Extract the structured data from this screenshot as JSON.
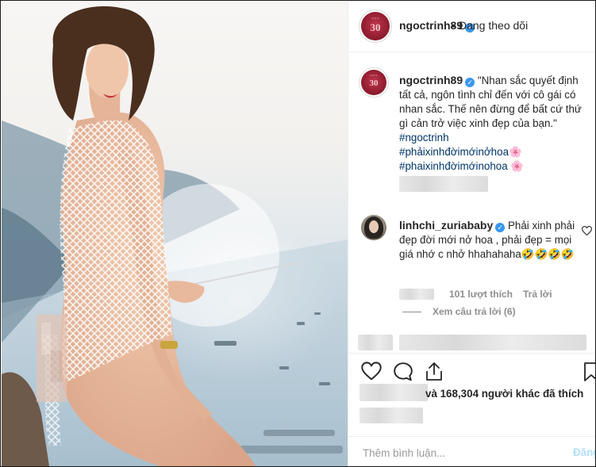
{
  "post": {
    "username": "ngoctrinh89",
    "follow_status": "Đang theo dõi",
    "avatar_badge": "30",
    "caption": "\"Nhan sắc quyết định tất cả, ngôn tình chỉ đến với cô gái có nhan sắc. Thế nên đừng để bất cứ thứ gì cản trở việc xinh đẹp của bạn.\"",
    "hashtags": [
      "#ngoctrinh",
      "#phảixinhđờimớinởhoa🌸",
      "#phaixinhđờimớinohoa 🌸"
    ]
  },
  "comment": {
    "username": "linhchi_zuriababy",
    "text": "Phải xinh phải đẹp đời mới nở hoa , phải đẹp = mọi giá nhớ c nhở hhahahaha🤣🤣🤣🤣",
    "likes": "101 lượt thích",
    "reply_label": "Trả lời",
    "view_replies": "Xem câu trả lời (6)"
  },
  "likes_summary": "và 168,304 người khác đã thích",
  "add_comment": {
    "placeholder": "Thêm bình luận...",
    "post_label": "Đăng"
  },
  "icons": {
    "like": "heart-icon",
    "comment": "comment-icon",
    "share": "share-icon",
    "save": "bookmark-icon",
    "verified": "verified-badge-icon"
  },
  "colors": {
    "verified": "#3897f0",
    "hashtag": "#003569",
    "muted": "#8e8e8e",
    "post_disabled": "#b2dffc"
  }
}
